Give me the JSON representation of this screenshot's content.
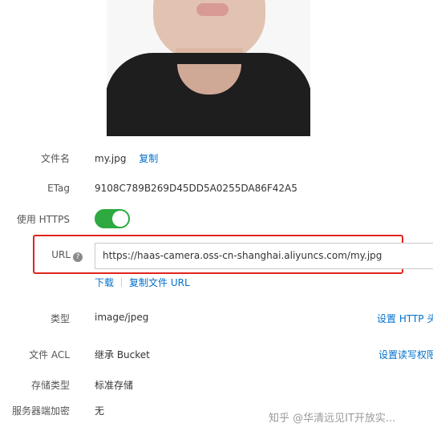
{
  "fields": {
    "filename": {
      "label": "文件名",
      "value": "my.jpg",
      "action": "复制"
    },
    "etag": {
      "label": "ETag",
      "value": "9108C789B269D45DD5A0255DA86F42A5"
    },
    "https": {
      "label": "使用 HTTPS",
      "enabled": true
    },
    "url": {
      "label": "URL",
      "help_icon": "?",
      "value": "https://haas-camera.oss-cn-shanghai.aliyuncs.com/my.jpg",
      "actions": [
        "下载",
        "复制文件 URL"
      ]
    },
    "type": {
      "label": "类型",
      "value": "image/jpeg",
      "action": "设置 HTTP 头"
    },
    "acl": {
      "label": "文件 ACL",
      "value": "继承 Bucket",
      "action": "设置读写权限"
    },
    "storage": {
      "label": "存储类型",
      "value": "标准存储"
    },
    "encryption": {
      "label": "服务器端加密",
      "value": "无"
    }
  },
  "colors": {
    "link": "#0070cc",
    "toggle_on": "#2da940",
    "highlight": "#e0251c"
  },
  "watermark": "知乎 @华清远见IT开放实..."
}
